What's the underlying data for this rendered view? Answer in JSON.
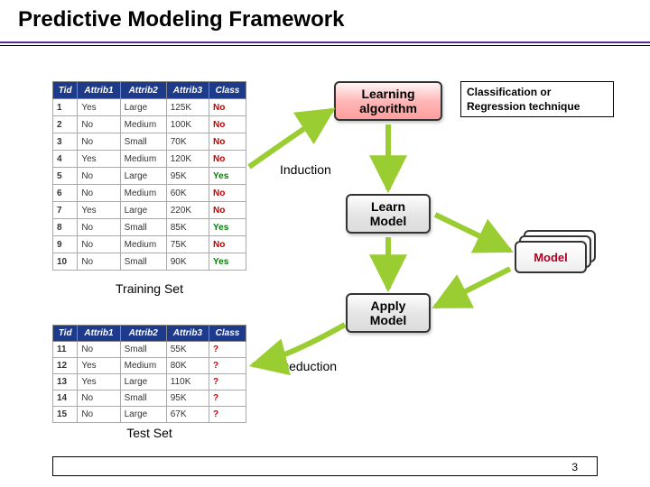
{
  "title": "Predictive Modeling Framework",
  "annotation": "Classification or Regression technique",
  "boxes": {
    "learning_algorithm": "Learning algorithm",
    "learn_model": "Learn Model",
    "apply_model": "Apply Model",
    "model": "Model"
  },
  "flow_labels": {
    "induction": "Induction",
    "deduction": "Deduction"
  },
  "set_labels": {
    "training": "Training Set",
    "test": "Test Set"
  },
  "table_headers": [
    "Tid",
    "Attrib1",
    "Attrib2",
    "Attrib3",
    "Class"
  ],
  "training_rows": [
    {
      "tid": "1",
      "a1": "Yes",
      "a2": "Large",
      "a3": "125K",
      "cls": "No"
    },
    {
      "tid": "2",
      "a1": "No",
      "a2": "Medium",
      "a3": "100K",
      "cls": "No"
    },
    {
      "tid": "3",
      "a1": "No",
      "a2": "Small",
      "a3": "70K",
      "cls": "No"
    },
    {
      "tid": "4",
      "a1": "Yes",
      "a2": "Medium",
      "a3": "120K",
      "cls": "No"
    },
    {
      "tid": "5",
      "a1": "No",
      "a2": "Large",
      "a3": "95K",
      "cls": "Yes"
    },
    {
      "tid": "6",
      "a1": "No",
      "a2": "Medium",
      "a3": "60K",
      "cls": "No"
    },
    {
      "tid": "7",
      "a1": "Yes",
      "a2": "Large",
      "a3": "220K",
      "cls": "No"
    },
    {
      "tid": "8",
      "a1": "No",
      "a2": "Small",
      "a3": "85K",
      "cls": "Yes"
    },
    {
      "tid": "9",
      "a1": "No",
      "a2": "Medium",
      "a3": "75K",
      "cls": "No"
    },
    {
      "tid": "10",
      "a1": "No",
      "a2": "Small",
      "a3": "90K",
      "cls": "Yes"
    }
  ],
  "test_rows": [
    {
      "tid": "11",
      "a1": "No",
      "a2": "Small",
      "a3": "55K",
      "cls": "?"
    },
    {
      "tid": "12",
      "a1": "Yes",
      "a2": "Medium",
      "a3": "80K",
      "cls": "?"
    },
    {
      "tid": "13",
      "a1": "Yes",
      "a2": "Large",
      "a3": "110K",
      "cls": "?"
    },
    {
      "tid": "14",
      "a1": "No",
      "a2": "Small",
      "a3": "95K",
      "cls": "?"
    },
    {
      "tid": "15",
      "a1": "No",
      "a2": "Large",
      "a3": "67K",
      "cls": "?"
    }
  ],
  "page_number": "3",
  "colors": {
    "accent": "#5b2d90",
    "arrow": "#9acd32"
  }
}
